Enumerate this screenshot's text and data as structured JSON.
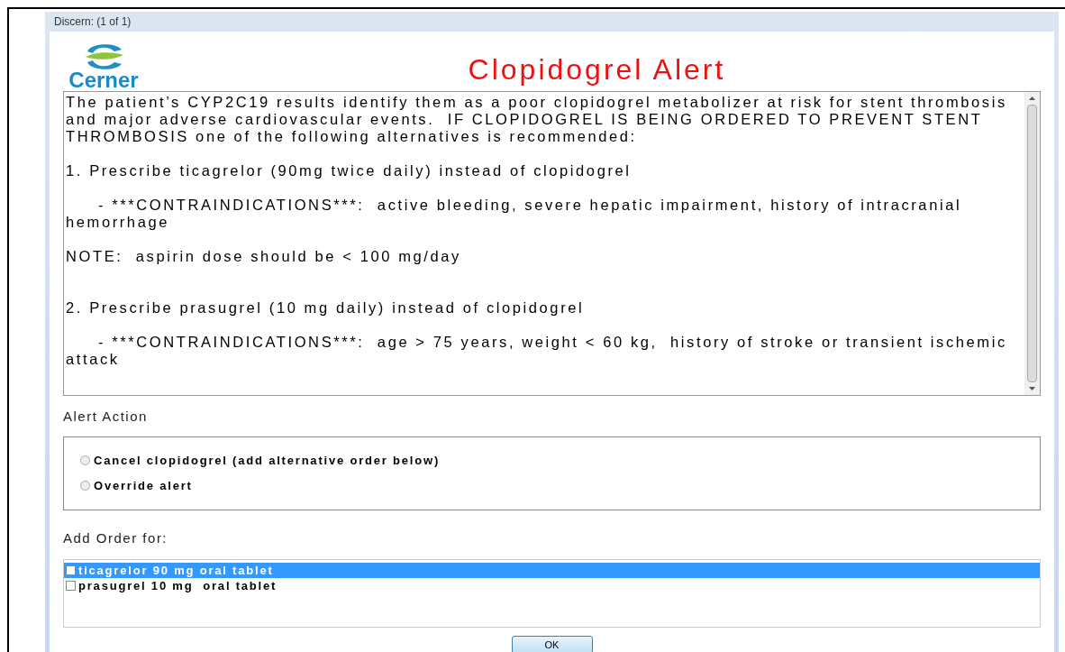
{
  "window": {
    "title": "Discern: (1 of 1)"
  },
  "logo": {
    "text": "Cerner"
  },
  "heading": "Clopidogrel Alert",
  "message": "The patient’s CYP2C19 results identify them as a poor clopidogrel metabolizer at risk for stent thrombosis and major adverse cardiovascular events.  IF CLOPIDOGREL IS BEING ORDERED TO PREVENT STENT THROMBOSIS one of the following alternatives is recommended:\n\n1. Prescribe ticagrelor (90mg twice daily) instead of clopidogrel\n\n     - ***CONTRAINDICATIONS***:  active bleeding, severe hepatic impairment, history of intracranial hemorrhage\n\nNOTE:  aspirin dose should be < 100 mg/day\n\n\n2. Prescribe prasugrel (10 mg daily) instead of clopidogrel\n\n     - ***CONTRAINDICATIONS***:  age > 75 years, weight < 60 kg,  history of stroke or transient ischemic attack",
  "alert_action": {
    "label": "Alert Action",
    "options": [
      {
        "label": "Cancel clopidogrel (add alternative order below)",
        "selected": false
      },
      {
        "label": "Override alert",
        "selected": false
      }
    ]
  },
  "add_order": {
    "label": "Add Order for:",
    "items": [
      {
        "label": "ticagrelor 90 mg oral tablet",
        "checked": false,
        "selected": true
      },
      {
        "label": "prasugrel 10 mg  oral tablet",
        "checked": false,
        "selected": false
      }
    ]
  },
  "ok_button": "OK"
}
